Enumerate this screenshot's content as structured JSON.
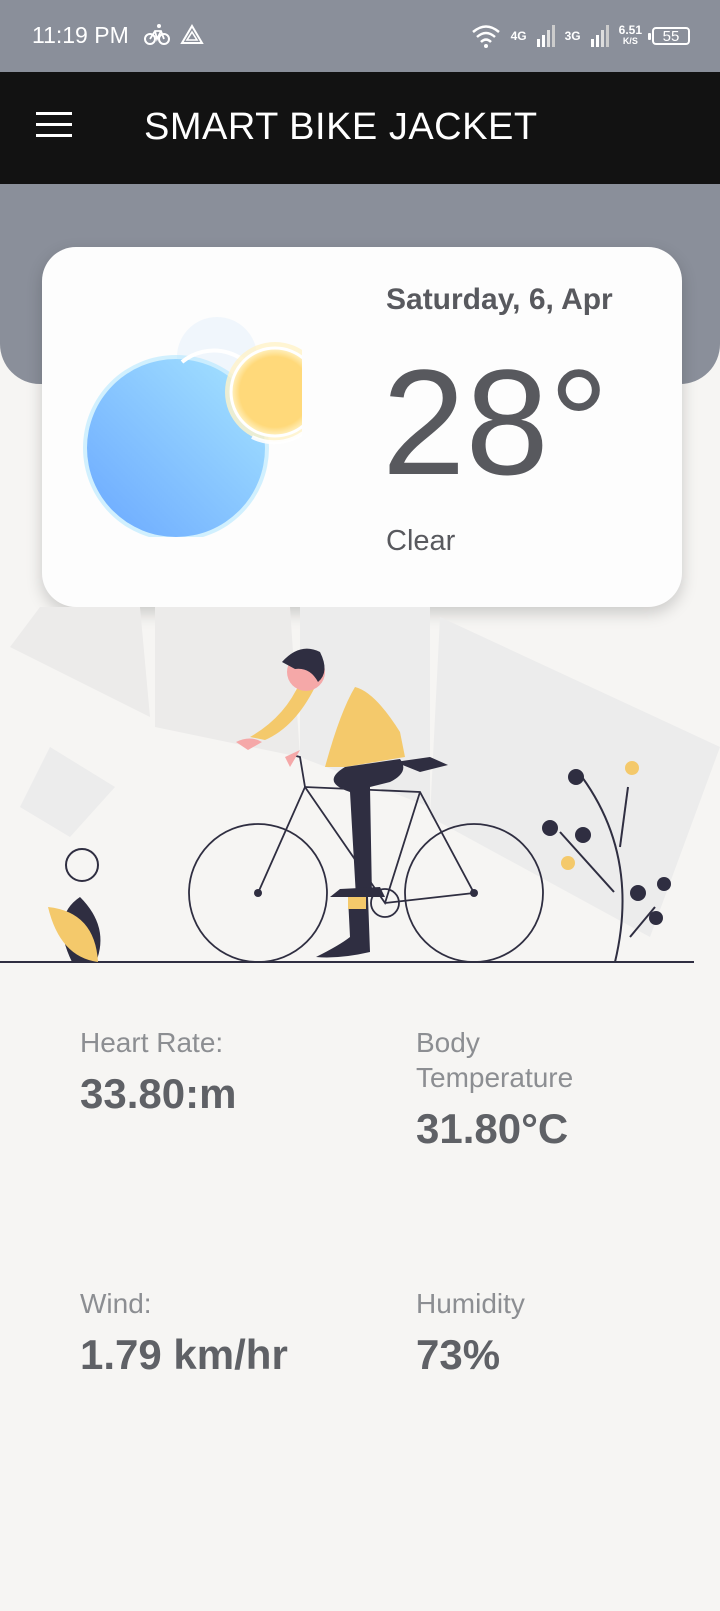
{
  "status_bar": {
    "time": "11:19 PM",
    "network_4g": "4G",
    "network_3g": "3G",
    "speed_value": "6.51",
    "speed_unit": "K/S",
    "battery": "55"
  },
  "app_bar": {
    "title": "SMART BIKE JACKET",
    "menu_icon": "hamburger-menu-icon"
  },
  "weather": {
    "date": "Saturday, 6, Apr",
    "temperature": "28°",
    "condition": "Clear",
    "icon": "clear-sky-icon"
  },
  "stats": {
    "heart_rate": {
      "label": "Heart Rate:",
      "value": "33.80:m"
    },
    "body_temp": {
      "label": "Body Temperature",
      "value": "31.80°C"
    },
    "wind": {
      "label": "Wind:",
      "value": "1.79 km/hr"
    },
    "humidity": {
      "label": "Humidity",
      "value": "73%"
    }
  },
  "colors": {
    "status_bar": "#8a8f9a",
    "app_bar": "#121212",
    "background": "#f6f5f3",
    "accent_yellow": "#f4c96b",
    "dark_navy": "#2f2e41"
  }
}
